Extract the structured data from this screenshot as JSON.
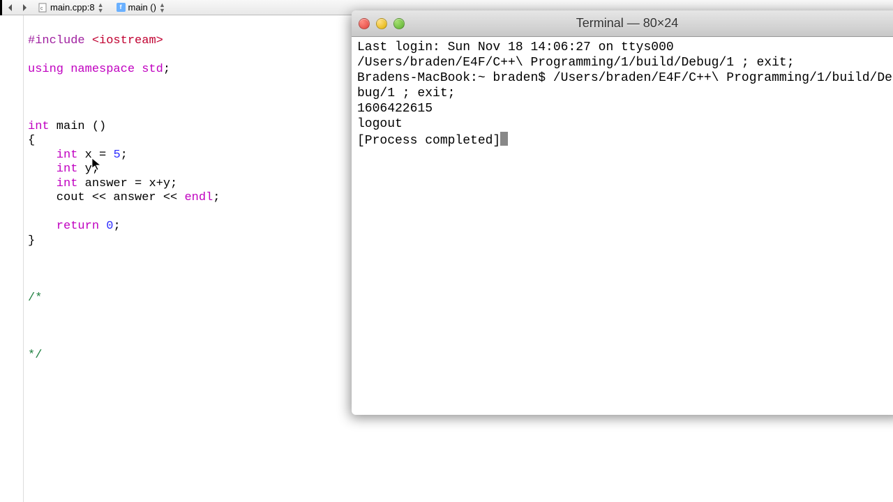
{
  "nav": {
    "file_label": "main.cpp:8",
    "func_label": "main ()"
  },
  "code": {
    "l1_a": "#include ",
    "l1_b": "<iostream>",
    "l2_a": "using",
    "l2_b": " namespace ",
    "l2_c": "std",
    "l2_d": ";",
    "l3_a": "int",
    "l3_b": " main ()",
    "l4": "{",
    "l5_a": "    int",
    "l5_b": " x = ",
    "l5_c": "5",
    "l5_d": ";",
    "l6_a": "    int",
    "l6_b": " y;",
    "l7_a": "    int",
    "l7_b": " answer = x+y;",
    "l8_a": "    cout << answer << ",
    "l8_b": "endl",
    "l8_c": ";",
    "l9_a": "    return",
    "l9_b": " ",
    "l9_c": "0",
    "l9_d": ";",
    "l10": "}",
    "l11": "/*",
    "l12": "*/"
  },
  "terminal": {
    "title": "Terminal — 80×24",
    "line1": "Last login: Sun Nov 18 14:06:27 on ttys000",
    "line2": "/Users/braden/E4F/C++\\ Programming/1/build/Debug/1 ; exit;",
    "line3": "Bradens-MacBook:~ braden$ /Users/braden/E4F/C++\\ Programming/1/build/Debug/1 ; exit;",
    "line4": "1606422615",
    "line5": "logout",
    "line6": "",
    "line7": "[Process completed]"
  }
}
